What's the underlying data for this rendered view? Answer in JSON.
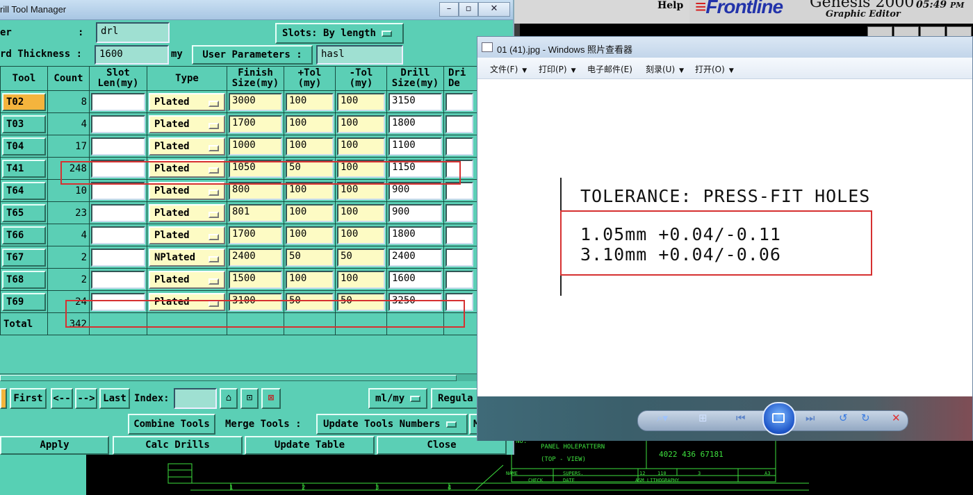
{
  "background_app": {
    "help": "Help",
    "logo": "Frontline",
    "product": "Genesis 2000",
    "subtitle": "Graphic Editor",
    "clock": "05:49",
    "clock_ampm": "PM"
  },
  "dtm": {
    "title": "rill Tool Manager",
    "layer_label": "er",
    "layer_sep": ":",
    "layer_value": "drl",
    "slots_label": "Slots:",
    "slots_value": "By length",
    "thickness_label": "rd Thickness :",
    "thickness_value": "1600",
    "thickness_unit": "my",
    "user_params_label": "User Parameters :",
    "user_params_value": "hasl",
    "columns": {
      "tool": "Tool",
      "count": "Count",
      "slot_len": [
        "Slot",
        "Len(my)"
      ],
      "type": "Type",
      "finish": [
        "Finish",
        "Size(my)"
      ],
      "ptol": [
        "+Tol",
        "(my)"
      ],
      "ntol": [
        "-Tol",
        "(my)"
      ],
      "drill": [
        "Drill",
        "Size(my)"
      ],
      "drill_dep": [
        "Dri",
        "De"
      ]
    },
    "rows": [
      {
        "tool": "T02",
        "count": "8",
        "slot": "",
        "type": "Plated",
        "finish": "3000",
        "ptol": "100",
        "ntol": "100",
        "drill": "3150"
      },
      {
        "tool": "T03",
        "count": "4",
        "slot": "",
        "type": "Plated",
        "finish": "1700",
        "ptol": "100",
        "ntol": "100",
        "drill": "1800"
      },
      {
        "tool": "T04",
        "count": "17",
        "slot": "",
        "type": "Plated",
        "finish": "1000",
        "ptol": "100",
        "ntol": "100",
        "drill": "1100"
      },
      {
        "tool": "T41",
        "count": "248",
        "slot": "",
        "type": "Plated",
        "finish": "1050",
        "ptol": "50",
        "ntol": "100",
        "drill": "1150"
      },
      {
        "tool": "T64",
        "count": "10",
        "slot": "",
        "type": "Plated",
        "finish": "800",
        "ptol": "100",
        "ntol": "100",
        "drill": "900"
      },
      {
        "tool": "T65",
        "count": "23",
        "slot": "",
        "type": "Plated",
        "finish": "801",
        "ptol": "100",
        "ntol": "100",
        "drill": "900"
      },
      {
        "tool": "T66",
        "count": "4",
        "slot": "",
        "type": "Plated",
        "finish": "1700",
        "ptol": "100",
        "ntol": "100",
        "drill": "1800"
      },
      {
        "tool": "T67",
        "count": "2",
        "slot": "",
        "type": "NPlated",
        "finish": "2400",
        "ptol": "50",
        "ntol": "50",
        "drill": "2400"
      },
      {
        "tool": "T68",
        "count": "2",
        "slot": "",
        "type": "Plated",
        "finish": "1500",
        "ptol": "100",
        "ntol": "100",
        "drill": "1600"
      },
      {
        "tool": "T69",
        "count": "24",
        "slot": "",
        "type": "Plated",
        "finish": "3100",
        "ptol": "50",
        "ntol": "50",
        "drill": "3250"
      }
    ],
    "total_label": "Total",
    "total_count": "342",
    "nav": {
      "first": "First",
      "prev": "<--",
      "next": "-->",
      "last": "Last",
      "index_label": "Index:",
      "index_value": "",
      "units": "ml/my",
      "regular": "Regula"
    },
    "actions": {
      "combine": "Combine Tools",
      "merge_label": "Merge Tools :",
      "update_numbers": "Update Tools Numbers",
      "cut": "M"
    },
    "bottom": {
      "apply": "Apply",
      "calc": "Calc Drills",
      "update_table": "Update Table",
      "close": "Close"
    }
  },
  "viewer": {
    "title": "01 (41).jpg - Windows 照片查看器",
    "menu": [
      "文件(F)",
      "打印(P)",
      "电子邮件(E)",
      "刻录(U)",
      "打开(O)"
    ],
    "document": {
      "heading": "TOLERANCE: PRESS-FIT HOLES",
      "line1": "1.05mm +0.04/-0.11",
      "line2": "3.10mm +0.04/-0.06"
    }
  },
  "cad": {
    "title_block": "PANEL HOLEPATTERN",
    "view": "(TOP - VIEW)",
    "part_no": "4022 436 67181",
    "row1": [
      "NAME",
      "SUPERS.",
      "12",
      "110",
      "3",
      "A3"
    ],
    "row2": [
      "CHECK",
      "DATE",
      "ASM LITHOGRAPHY"
    ],
    "ruler": [
      "1",
      "2",
      "3",
      "4"
    ],
    "sheet": "NO."
  }
}
